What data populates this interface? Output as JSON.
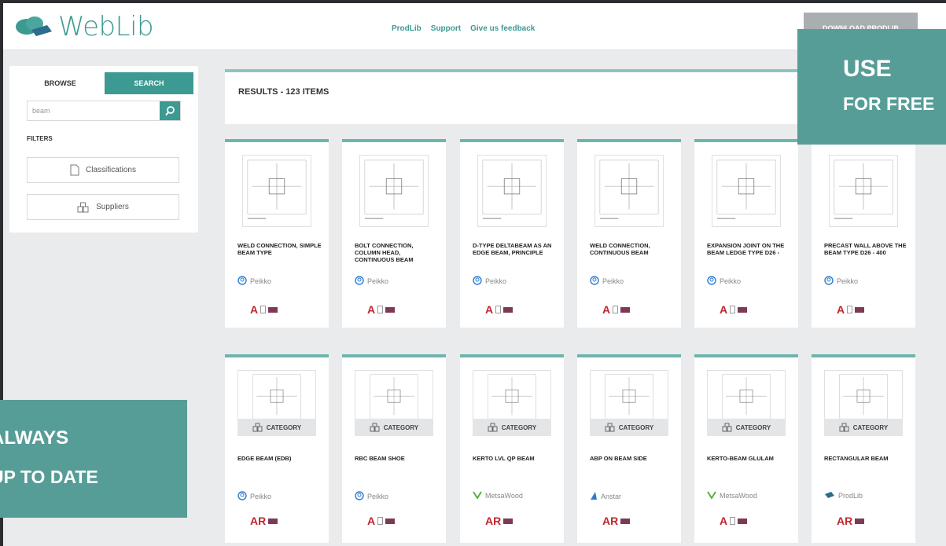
{
  "app": {
    "title": "WebLib"
  },
  "nav": [
    "ProdLib",
    "Support",
    "Give us feedback"
  ],
  "download_label": "DOWNLOAD PRODLIB",
  "sidebar": {
    "tabs": [
      {
        "label": "BROWSE"
      },
      {
        "label": "SEARCH"
      }
    ],
    "search_value": "beam",
    "filters_label": "FILTERS",
    "filter_buttons": [
      {
        "label": "Classifications"
      },
      {
        "label": "Suppliers"
      }
    ]
  },
  "results": {
    "title": "RESULTS - 123 ITEMS"
  },
  "promo": {
    "top": {
      "line1": "USE",
      "line2": "FOR FREE"
    },
    "bottom": {
      "line1": "ALWAYS",
      "line2": "UP TO DATE"
    }
  },
  "category_label": "CATEGORY",
  "cards_row1": [
    {
      "title": "WELD CONNECTION, SIMPLE BEAM TYPE",
      "supplier": "Peikko",
      "formats": "A"
    },
    {
      "title": "BOLT CONNECTION, COLUMN HEAD, CONTINUOUS BEAM",
      "supplier": "Peikko",
      "formats": "A"
    },
    {
      "title": "D-TYPE DELTABEAM AS AN EDGE BEAM, PRINCIPLE",
      "supplier": "Peikko",
      "formats": "A"
    },
    {
      "title": "WELD CONNECTION, CONTINUOUS BEAM",
      "supplier": "Peikko",
      "formats": "A"
    },
    {
      "title": "EXPANSION JOINT ON THE BEAM LEDGE TYPE D26 -",
      "supplier": "Peikko",
      "formats": "A"
    },
    {
      "title": "PRECAST WALL ABOVE THE BEAM TYPE D26 - 400",
      "supplier": "Peikko",
      "formats": "A"
    }
  ],
  "cards_row2": [
    {
      "title": "EDGE BEAM (EDB)",
      "supplier": "Peikko",
      "formats": "AR"
    },
    {
      "title": "RBC BEAM SHOE",
      "supplier": "Peikko",
      "formats": "A"
    },
    {
      "title": "KERTO LVL QP BEAM",
      "supplier": "MetsaWood",
      "formats": "AR"
    },
    {
      "title": "ABP ON BEAM SIDE",
      "supplier": "Anstar",
      "formats": "AR"
    },
    {
      "title": "KERTO-BEAM GLULAM",
      "supplier": "MetsaWood",
      "formats": "A"
    },
    {
      "title": "RECTANGULAR BEAM",
      "supplier": "ProdLib",
      "formats": "AR"
    }
  ]
}
